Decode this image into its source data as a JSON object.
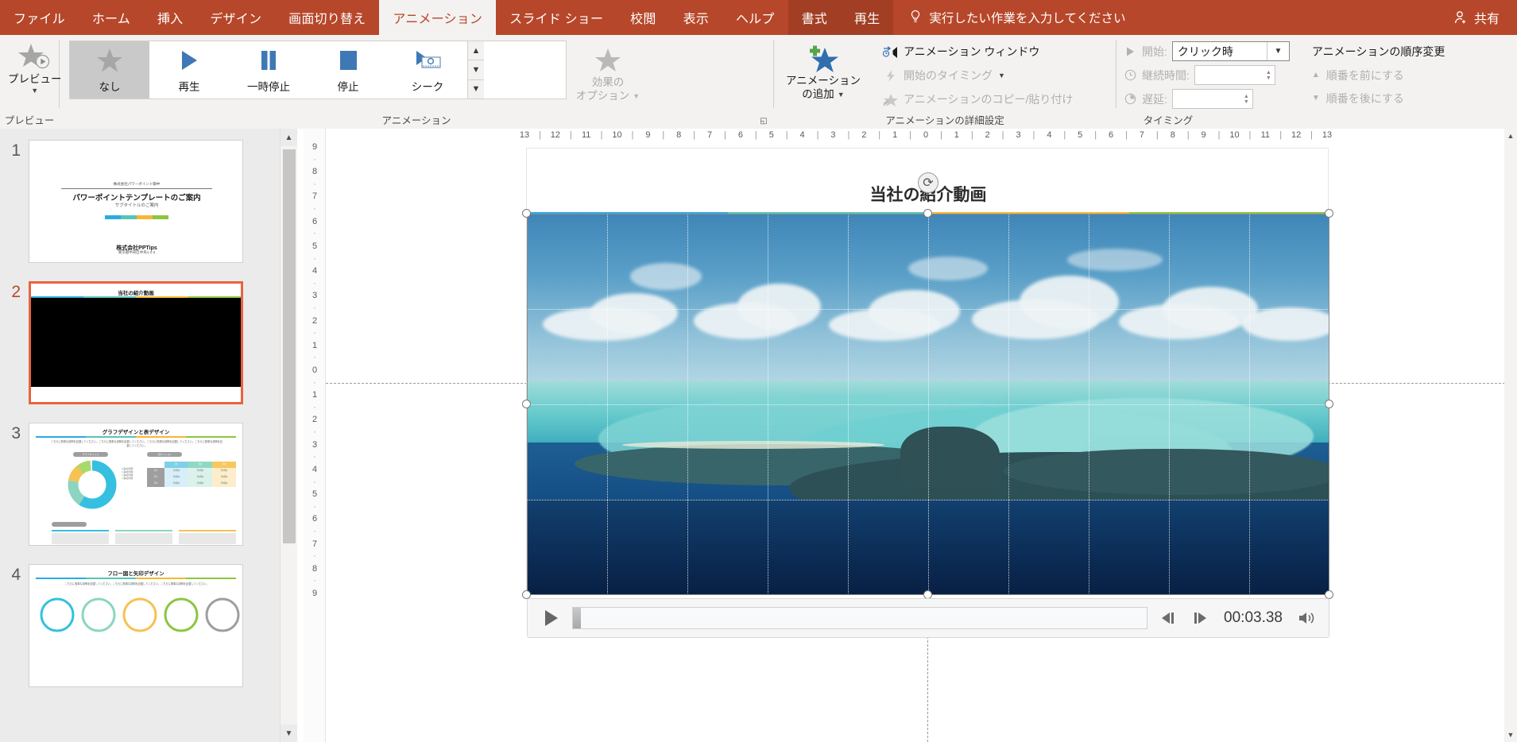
{
  "tabs": [
    {
      "label": "ファイル",
      "state": "file"
    },
    {
      "label": "ホーム",
      "state": "normal"
    },
    {
      "label": "挿入",
      "state": "normal"
    },
    {
      "label": "デザイン",
      "state": "normal"
    },
    {
      "label": "画面切り替え",
      "state": "normal"
    },
    {
      "label": "アニメーション",
      "state": "active"
    },
    {
      "label": "スライド ショー",
      "state": "normal"
    },
    {
      "label": "校閲",
      "state": "normal"
    },
    {
      "label": "表示",
      "state": "normal"
    },
    {
      "label": "ヘルプ",
      "state": "normal"
    },
    {
      "label": "書式",
      "state": "contextual"
    },
    {
      "label": "再生",
      "state": "contextual"
    }
  ],
  "tellme": {
    "placeholder": "実行したい作業を入力してください",
    "icon": "lightbulb-icon"
  },
  "share": {
    "label": "共有",
    "icon": "share-person-icon"
  },
  "ribbon": {
    "groups": [
      {
        "name": "preview",
        "label": "プレビュー"
      },
      {
        "name": "animation",
        "label": "アニメーション"
      },
      {
        "name": "advanced_animation",
        "label": "アニメーションの詳細設定"
      },
      {
        "name": "timing",
        "label": "タイミング"
      }
    ],
    "preview": {
      "button_label": "プレビュー",
      "icon": "star-play-icon"
    },
    "gallery": {
      "items": [
        {
          "label": "なし",
          "icon": "gray-star-icon",
          "selected": true
        },
        {
          "label": "再生",
          "icon": "blue-triangle-icon",
          "selected": false
        },
        {
          "label": "一時停止",
          "icon": "blue-pause-icon",
          "selected": false
        },
        {
          "label": "停止",
          "icon": "blue-square-icon",
          "selected": false
        },
        {
          "label": "シーク",
          "icon": "seek-icon",
          "selected": false
        }
      ],
      "scroll_up": "▲",
      "scroll_down": "▼",
      "scroll_more": "▼"
    },
    "effect_options": {
      "label_line1": "効果の",
      "label_line2": "オプション",
      "icon": "gray-star-icon",
      "enabled": false
    },
    "add_animation": {
      "label_line1": "アニメーション",
      "label_line2": "の追加",
      "icon": "plus-star-icon",
      "enabled": true
    },
    "advanced": [
      {
        "label": "アニメーション ウィンドウ",
        "icon": "animation-pane-icon",
        "enabled": true
      },
      {
        "label": "開始のタイミング",
        "icon": "lightning-icon",
        "enabled": false,
        "has_caret": true
      },
      {
        "label": "アニメーションのコピー/貼り付け",
        "icon": "animation-painter-icon",
        "enabled": false
      }
    ],
    "timing": {
      "start": {
        "label": "開始:",
        "value": "クリック時",
        "icon": "play-triangle-icon"
      },
      "duration": {
        "label": "継続時間:",
        "value": "",
        "icon": "clock-icon"
      },
      "delay": {
        "label": "遅延:",
        "value": "",
        "icon": "clock-delay-icon"
      }
    },
    "reorder": {
      "heading": "アニメーションの順序変更",
      "move_earlier": "順番を前にする",
      "move_later": "順番を後にする"
    },
    "collapse_icon": "chevron-up-icon"
  },
  "thumbnails": [
    {
      "number": "1",
      "selected": false,
      "kind": "title",
      "eyebrow": "株式会社パワーポイント御中",
      "title": "パワーポイントテンプレートのご案内",
      "subtitle": "サブタイトルのご案内",
      "footer_company": "株式会社PPTips",
      "footer_sub": "東京都中央区中央1-2-3"
    },
    {
      "number": "2",
      "selected": true,
      "kind": "video",
      "title": "当社の紹介動画"
    },
    {
      "number": "3",
      "selected": false,
      "kind": "chart",
      "title": "グラフデザインと表デザイン",
      "body": "こちらに簡単な説明を記載してください。こちらに簡単な説明を記載してください。こちらに簡単な説明を記載してください。こちらに簡単な説明を記載してください。",
      "chart_caption": "グラフタイトル",
      "table_caption": "表タイトル1",
      "table_headers": [
        "",
        "列1",
        "列2",
        "列3"
      ],
      "table_rows": [
        [
          "行1",
          "行1列1",
          "行1列2",
          "行1列3"
        ],
        [
          "行2",
          "行2列1",
          "行2列2",
          "行2列3"
        ],
        [
          "行3",
          "行3列1",
          "行3列2",
          "行3列3"
        ]
      ],
      "legend": [
        "第1四半期",
        "第2四半期",
        "第3四半期",
        "第4四半期"
      ]
    },
    {
      "number": "4",
      "selected": false,
      "kind": "flow",
      "title": "フロー図と矢印デザイン",
      "body": "こちらに簡単な説明を記載してください。こちらに簡単な説明を記載してください。こちらに簡単な説明を記載してください。"
    }
  ],
  "ruler": {
    "horizontal": [
      "13",
      "12",
      "11",
      "10",
      "9",
      "8",
      "7",
      "6",
      "5",
      "4",
      "3",
      "2",
      "1",
      "0",
      "1",
      "2",
      "3",
      "4",
      "5",
      "6",
      "7",
      "8",
      "9",
      "10",
      "11",
      "12",
      "13"
    ],
    "vertical": [
      "9",
      "8",
      "7",
      "6",
      "5",
      "4",
      "3",
      "2",
      "1",
      "0",
      "1",
      "2",
      "3",
      "4",
      "5",
      "6",
      "7",
      "8",
      "9"
    ]
  },
  "slide": {
    "title": "当社の紹介動画",
    "colorbar": [
      "#29abe2",
      "#57c5b6",
      "#f7b733",
      "#8cc63f"
    ],
    "selected_object": "video-placeholder"
  },
  "media_controls": {
    "play_icon": "play-icon",
    "back_icon": "step-back-icon",
    "forward_icon": "step-forward-icon",
    "volume_icon": "volume-icon",
    "time": "00:03.38",
    "progress_percent": 1
  },
  "colors": {
    "ribbon_accent": "#b7472a",
    "contextual_tab": "#a23e23",
    "selection_orange": "#e8633f",
    "office_blue": "#4472a8"
  }
}
